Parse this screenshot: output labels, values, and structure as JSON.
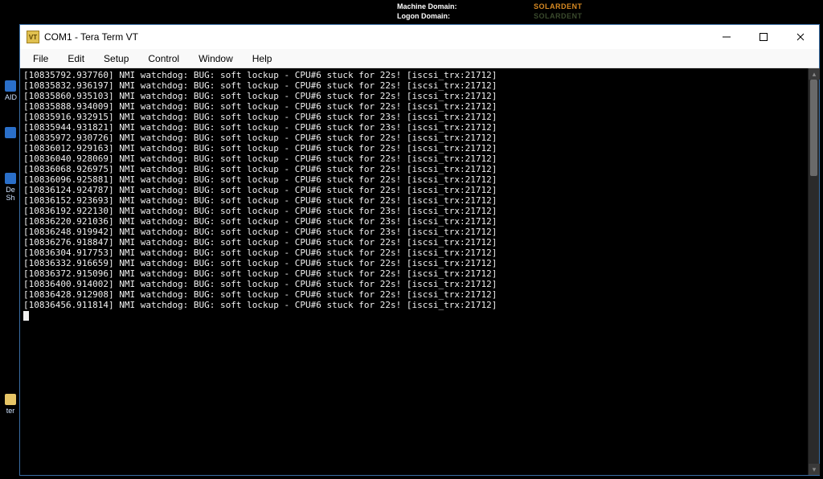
{
  "top_info": {
    "label1": "Machine Domain:",
    "value1": "SOLARDENT",
    "label2": "Logon Domain:",
    "value2": "SOLARDENT"
  },
  "desktop_icons": {
    "raid": "AID",
    "de": "De",
    "sh": "Sh",
    "ter": "ter"
  },
  "window": {
    "title": "COM1 - Tera Term VT",
    "app_icon_text": "VT"
  },
  "menu": {
    "file": "File",
    "edit": "Edit",
    "setup": "Setup",
    "control": "Control",
    "window": "Window",
    "help": "Help"
  },
  "terminal_lines": [
    "[10835792.937760] NMI watchdog: BUG: soft lockup - CPU#6 stuck for 22s! [iscsi_trx:21712]",
    "[10835832.936197] NMI watchdog: BUG: soft lockup - CPU#6 stuck for 22s! [iscsi_trx:21712]",
    "[10835860.935103] NMI watchdog: BUG: soft lockup - CPU#6 stuck for 22s! [iscsi_trx:21712]",
    "[10835888.934009] NMI watchdog: BUG: soft lockup - CPU#6 stuck for 22s! [iscsi_trx:21712]",
    "[10835916.932915] NMI watchdog: BUG: soft lockup - CPU#6 stuck for 23s! [iscsi_trx:21712]",
    "[10835944.931821] NMI watchdog: BUG: soft lockup - CPU#6 stuck for 23s! [iscsi_trx:21712]",
    "[10835972.930726] NMI watchdog: BUG: soft lockup - CPU#6 stuck for 22s! [iscsi_trx:21712]",
    "[10836012.929163] NMI watchdog: BUG: soft lockup - CPU#6 stuck for 22s! [iscsi_trx:21712]",
    "[10836040.928069] NMI watchdog: BUG: soft lockup - CPU#6 stuck for 22s! [iscsi_trx:21712]",
    "[10836068.926975] NMI watchdog: BUG: soft lockup - CPU#6 stuck for 22s! [iscsi_trx:21712]",
    "[10836096.925881] NMI watchdog: BUG: soft lockup - CPU#6 stuck for 22s! [iscsi_trx:21712]",
    "[10836124.924787] NMI watchdog: BUG: soft lockup - CPU#6 stuck for 22s! [iscsi_trx:21712]",
    "[10836152.923693] NMI watchdog: BUG: soft lockup - CPU#6 stuck for 22s! [iscsi_trx:21712]",
    "[10836192.922130] NMI watchdog: BUG: soft lockup - CPU#6 stuck for 23s! [iscsi_trx:21712]",
    "[10836220.921036] NMI watchdog: BUG: soft lockup - CPU#6 stuck for 23s! [iscsi_trx:21712]",
    "[10836248.919942] NMI watchdog: BUG: soft lockup - CPU#6 stuck for 23s! [iscsi_trx:21712]",
    "[10836276.918847] NMI watchdog: BUG: soft lockup - CPU#6 stuck for 22s! [iscsi_trx:21712]",
    "[10836304.917753] NMI watchdog: BUG: soft lockup - CPU#6 stuck for 22s! [iscsi_trx:21712]",
    "[10836332.916659] NMI watchdog: BUG: soft lockup - CPU#6 stuck for 22s! [iscsi_trx:21712]",
    "[10836372.915096] NMI watchdog: BUG: soft lockup - CPU#6 stuck for 22s! [iscsi_trx:21712]",
    "[10836400.914002] NMI watchdog: BUG: soft lockup - CPU#6 stuck for 22s! [iscsi_trx:21712]",
    "[10836428.912908] NMI watchdog: BUG: soft lockup - CPU#6 stuck for 22s! [iscsi_trx:21712]",
    "[10836456.911814] NMI watchdog: BUG: soft lockup - CPU#6 stuck for 22s! [iscsi_trx:21712]"
  ]
}
